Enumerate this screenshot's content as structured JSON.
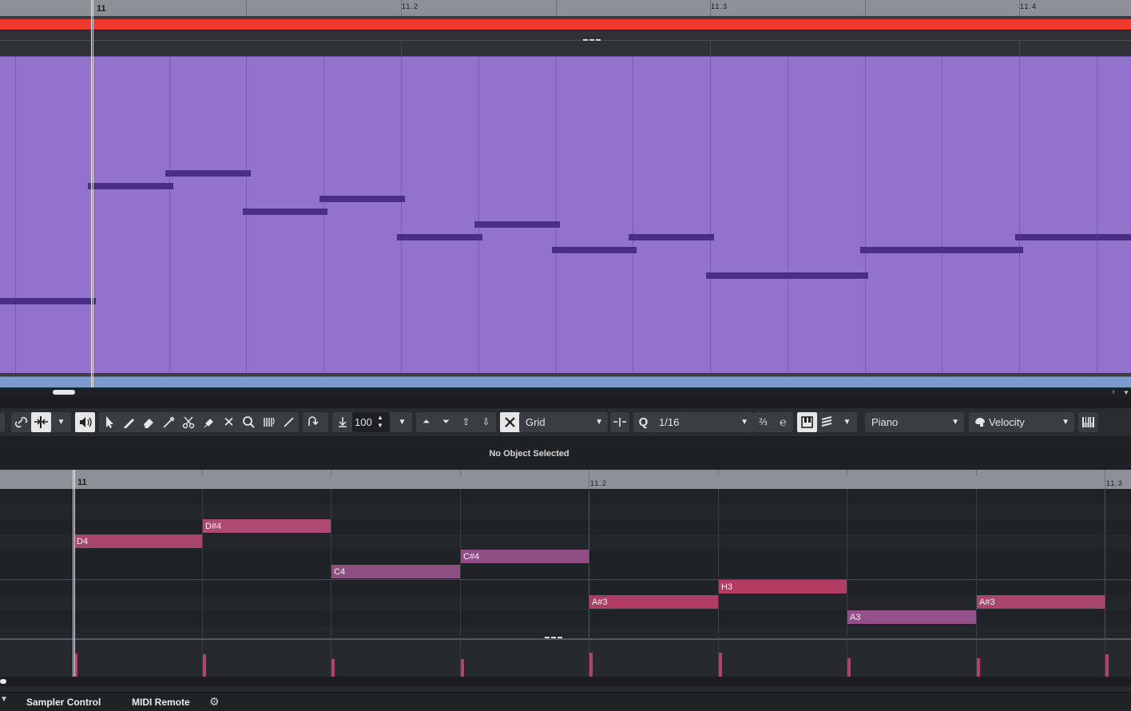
{
  "arrange": {
    "ruler": {
      "bar_label": "11",
      "beat2_label": "11.2",
      "beat3_label": "11.3",
      "beat4_label": "11.4"
    },
    "part_color": "#9272cc",
    "cycle_color": "#f0392e"
  },
  "toolbar": {
    "quantize_value": "100",
    "snap_type": "Grid",
    "quantize_preset": "1/16",
    "key_editor_mode": "Piano",
    "controller_lane": "Velocity"
  },
  "info_line": {
    "status_text": "No Object Selected"
  },
  "editor": {
    "ruler": {
      "bar_label": "11",
      "beat2_label": "11.2",
      "beat3_label": "11.3"
    },
    "notes": [
      {
        "pitch": "D4"
      },
      {
        "pitch": "D#4"
      },
      {
        "pitch": "C4"
      },
      {
        "pitch": "C#4"
      },
      {
        "pitch": "A#3"
      },
      {
        "pitch": "H3"
      },
      {
        "pitch": "A3"
      },
      {
        "pitch": "A#3"
      }
    ],
    "velocities": [
      0.62,
      0.6,
      0.48,
      0.48,
      0.65,
      0.65,
      0.5,
      0.5,
      0.6
    ]
  },
  "bottom_tabs": {
    "sampler_control": "Sampler Control",
    "midi_remote": "MIDI Remote"
  }
}
